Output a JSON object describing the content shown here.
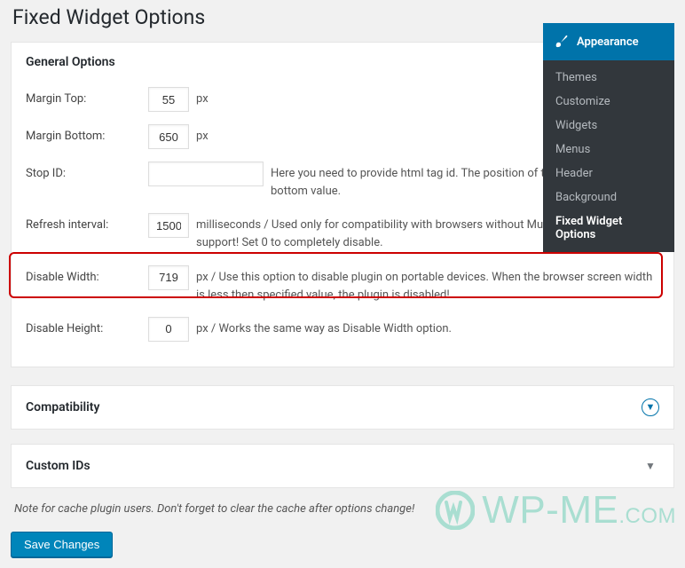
{
  "page_title": "Fixed Widget Options",
  "general": {
    "heading": "General Options",
    "margin_top": {
      "label": "Margin Top:",
      "value": "55",
      "unit": "px"
    },
    "margin_bottom": {
      "label": "Margin Bottom:",
      "value": "650",
      "unit": "px"
    },
    "stop_id": {
      "label": "Stop ID:",
      "value": "",
      "desc": "Here you need to provide html tag id. The position of that html margin bottom value."
    },
    "refresh_interval": {
      "label": "Refresh interval:",
      "value": "1500",
      "desc": "milliseconds / Used only for compatibility with browsers without MutationObserver API support! Set 0 to completely disable."
    },
    "disable_width": {
      "label": "Disable Width:",
      "value": "719",
      "desc": "px / Use this option to disable plugin on portable devices. When the browser screen width is less then specified value, the plugin is disabled!"
    },
    "disable_height": {
      "label": "Disable Height:",
      "value": "0",
      "desc": "px / Works the same way as Disable Width option."
    }
  },
  "sections": {
    "compatibility": "Compatibility",
    "custom_ids": "Custom IDs"
  },
  "cache_note": "Note for cache plugin users. Don't forget to clear the cache after options change!",
  "save_button": "Save Changes",
  "flyout": {
    "heading": "Appearance",
    "items": [
      "Themes",
      "Customize",
      "Widgets",
      "Menus",
      "Header",
      "Background",
      "Fixed Widget Options"
    ],
    "current": "Fixed Widget Options"
  },
  "watermark": {
    "main": "WP-ME",
    "ext": ".COM"
  }
}
